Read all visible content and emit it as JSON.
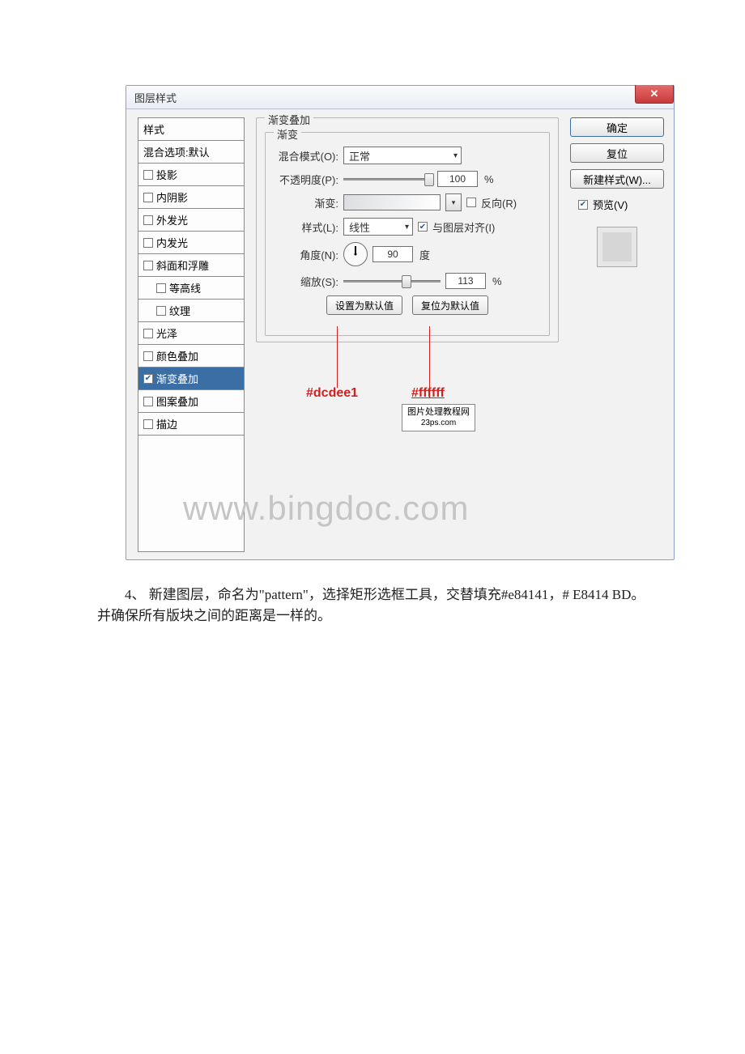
{
  "dialog": {
    "title": "图层样式",
    "close": "✕",
    "styles_list": {
      "header": "样式",
      "blending": "混合选项:默认",
      "drop_shadow": "投影",
      "inner_shadow": "内阴影",
      "outer_glow": "外发光",
      "inner_glow": "内发光",
      "bevel_emboss": "斜面和浮雕",
      "contour": "等高线",
      "texture": "纹理",
      "satin": "光泽",
      "color_overlay": "颜色叠加",
      "gradient_overlay": "渐变叠加",
      "pattern_overlay": "图案叠加",
      "stroke": "描边"
    },
    "panel": {
      "legend_outer": "渐变叠加",
      "legend_inner": "渐变",
      "blend_mode_label": "混合模式(O):",
      "blend_mode_value": "正常",
      "opacity_label": "不透明度(P):",
      "opacity_value": "100",
      "percent": "%",
      "gradient_label": "渐变:",
      "reverse_label": "反向(R)",
      "style_label": "样式(L):",
      "style_value": "线性",
      "align_label": "与图层对齐(I)",
      "angle_label": "角度(N):",
      "angle_value": "90",
      "angle_unit": "度",
      "scale_label": "缩放(S):",
      "scale_value": "113",
      "set_default": "设置为默认值",
      "reset_default": "复位为默认值"
    },
    "right": {
      "ok": "确定",
      "cancel": "复位",
      "new_style": "新建样式(W)...",
      "preview": "预览(V)"
    }
  },
  "annotation": {
    "color1": "#dcdee1",
    "color2": "#ffffff",
    "small_watermark_line1": "图片处理教程网",
    "small_watermark_line2": "23ps.com",
    "big_watermark": "www.bingdoc.com"
  },
  "body_paragraph": "　　4、 新建图层，命名为\"pattern\"，选择矩形选框工具，交替填充#e84141，# E8414 BD。并确保所有版块之间的距离是一样的。"
}
